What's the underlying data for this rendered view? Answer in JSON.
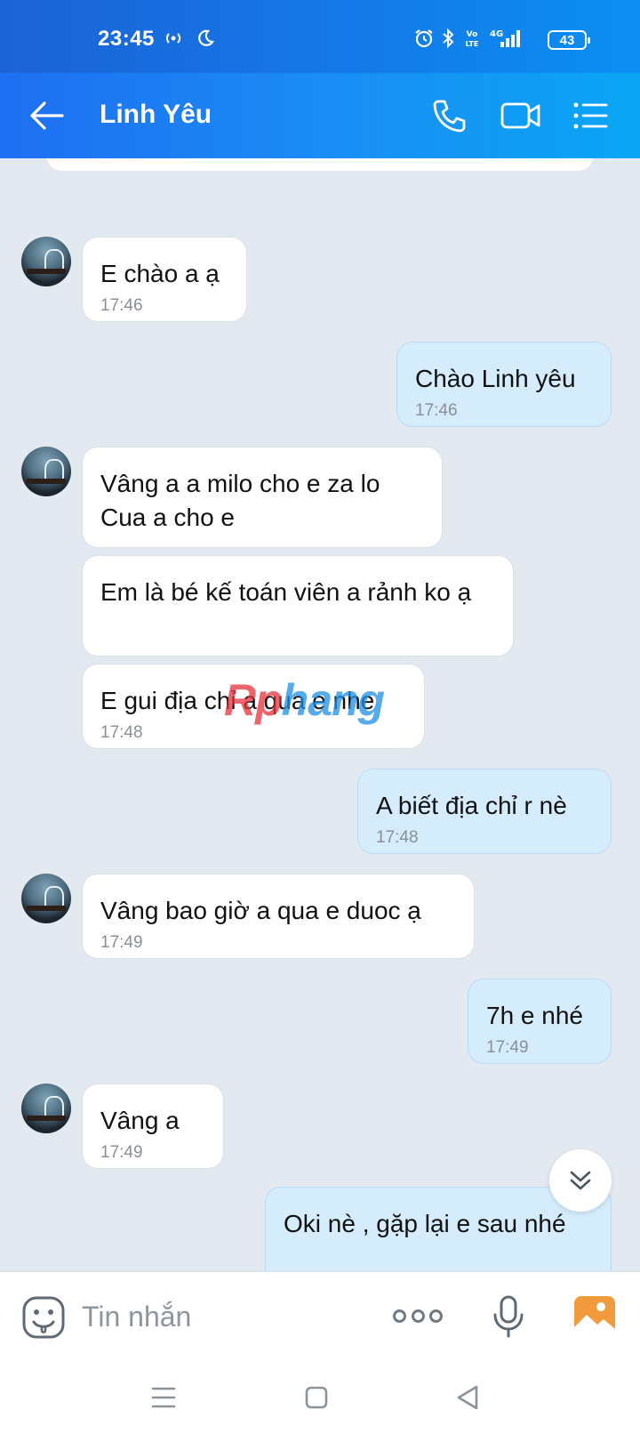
{
  "status_bar": {
    "time": "23:45",
    "battery": "43",
    "icons": [
      "hotspot-icon",
      "do-not-disturb-moon-icon",
      "alarm-icon",
      "bluetooth-icon",
      "volte-icon",
      "4g-signal-icon",
      "battery-icon"
    ]
  },
  "header": {
    "contact_name": "Linh Yêu",
    "actions": [
      "back-arrow-icon",
      "phone-call-icon",
      "video-call-icon",
      "menu-list-icon"
    ]
  },
  "messages": [
    {
      "side": "in",
      "text": "E chào a ạ",
      "time": "17:46"
    },
    {
      "side": "out",
      "text": "Chào Linh yêu",
      "time": "17:46"
    },
    {
      "side": "in",
      "text": "Vâng a a milo cho e za lo Cua a cho e",
      "time": ""
    },
    {
      "side": "in",
      "text": "Em là bé kế toán viên a rảnh ko ạ",
      "time": ""
    },
    {
      "side": "in",
      "text": "E gui địa chỉ a qua e nhe",
      "time": "17:48"
    },
    {
      "side": "out",
      "text": "A biết địa chỉ r nè",
      "time": "17:48"
    },
    {
      "side": "in",
      "text": "Vâng bao giờ a qua e duoc ạ",
      "time": "17:49"
    },
    {
      "side": "out",
      "text": "7h e nhé",
      "time": "17:49"
    },
    {
      "side": "in",
      "text": "Vâng a",
      "time": "17:49"
    },
    {
      "side": "out",
      "text": "Oki nè , gặp lại e sau nhé",
      "time": ""
    }
  ],
  "watermark": {
    "part1": "Rp",
    "part2": "hang"
  },
  "input_bar": {
    "placeholder": "Tin nhắn",
    "icons": [
      "emoji-sticker-icon",
      "more-dots-icon",
      "microphone-icon",
      "image-gallery-icon"
    ]
  },
  "nav_bar": {
    "icons": [
      "recent-apps-icon",
      "home-icon",
      "back-icon"
    ]
  },
  "colors": {
    "header_start": "#1e6ff2",
    "header_end": "#0aa6f5",
    "incoming_bubble": "#ffffff",
    "outgoing_bubble": "#d5ecfd",
    "chat_background": "#e3e9f0"
  }
}
